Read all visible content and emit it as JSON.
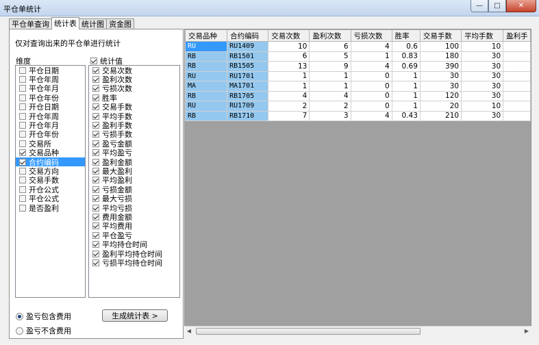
{
  "window": {
    "title": "平仓单统计",
    "min": "—",
    "max": "□",
    "close": "✕"
  },
  "tabs": [
    {
      "label": "平仓单查询",
      "active": false
    },
    {
      "label": "统计表",
      "active": true
    },
    {
      "label": "统计图",
      "active": false
    },
    {
      "label": "资金图",
      "active": false
    }
  ],
  "panel": {
    "hint": "仅对查询出来的平仓单进行统计",
    "dimension_label": "维度",
    "stat_label": "统计值",
    "stat_checked": true,
    "dimensions": [
      {
        "label": "平仓日期",
        "checked": false,
        "selected": false
      },
      {
        "label": "平仓年周",
        "checked": false,
        "selected": false
      },
      {
        "label": "平仓年月",
        "checked": false,
        "selected": false
      },
      {
        "label": "平仓年份",
        "checked": false,
        "selected": false
      },
      {
        "label": "开仓日期",
        "checked": false,
        "selected": false
      },
      {
        "label": "开仓年周",
        "checked": false,
        "selected": false
      },
      {
        "label": "开仓年月",
        "checked": false,
        "selected": false
      },
      {
        "label": "开仓年份",
        "checked": false,
        "selected": false
      },
      {
        "label": "交易所",
        "checked": false,
        "selected": false
      },
      {
        "label": "交易品种",
        "checked": true,
        "selected": false
      },
      {
        "label": "合约编码",
        "checked": true,
        "selected": true
      },
      {
        "label": "交易方向",
        "checked": false,
        "selected": false
      },
      {
        "label": "交易手数",
        "checked": false,
        "selected": false
      },
      {
        "label": "开仓公式",
        "checked": false,
        "selected": false
      },
      {
        "label": "平仓公式",
        "checked": false,
        "selected": false
      },
      {
        "label": "是否盈利",
        "checked": false,
        "selected": false
      }
    ],
    "stats": [
      "交易次数",
      "盈利次数",
      "亏损次数",
      "胜率",
      "交易手数",
      "平均手数",
      "盈利手数",
      "亏损手数",
      "盈亏金额",
      "平均盈亏",
      "盈利金额",
      "最大盈利",
      "平均盈利",
      "亏损金额",
      "最大亏损",
      "平均亏损",
      "费用金额",
      "平均费用",
      "平仓盈亏",
      "平均持仓时间",
      "盈利平均持仓时间",
      "亏损平均持仓时间"
    ],
    "radio_include": "盈亏包含费用",
    "radio_exclude": "盈亏不含费用",
    "radio_selected": "include",
    "generate_button": "生成统计表 >"
  },
  "grid": {
    "columns": [
      "交易品种",
      "合约编码",
      "交易次数",
      "盈利次数",
      "亏损次数",
      "胜率",
      "交易手数",
      "平均手数",
      "盈利手"
    ],
    "rows": [
      [
        "RU",
        "RU1409",
        "10",
        "6",
        "4",
        "0.6",
        "100",
        "10",
        ""
      ],
      [
        "RB",
        "RB1501",
        "6",
        "5",
        "1",
        "0.83",
        "180",
        "30",
        ""
      ],
      [
        "RB",
        "RB1505",
        "13",
        "9",
        "4",
        "0.69",
        "390",
        "30",
        ""
      ],
      [
        "RU",
        "RU1701",
        "1",
        "1",
        "0",
        "1",
        "30",
        "30",
        ""
      ],
      [
        "MA",
        "MA1701",
        "1",
        "1",
        "0",
        "1",
        "30",
        "30",
        ""
      ],
      [
        "RB",
        "RB1705",
        "4",
        "4",
        "0",
        "1",
        "120",
        "30",
        ""
      ],
      [
        "RU",
        "RU1709",
        "2",
        "2",
        "0",
        "1",
        "20",
        "10",
        ""
      ],
      [
        "RB",
        "RB1710",
        "7",
        "3",
        "4",
        "0.43",
        "210",
        "30",
        ""
      ]
    ],
    "scroll_left": "◀",
    "scroll_right": "▶"
  }
}
